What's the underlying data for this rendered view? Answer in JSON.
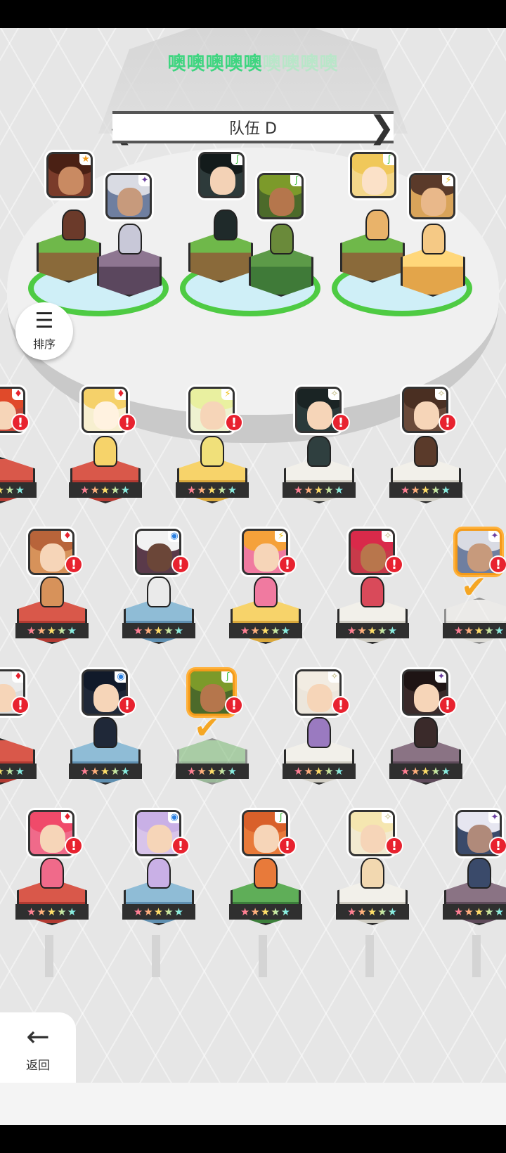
{
  "banner": {
    "lit_text": "噢噢噢噢噢",
    "dim_text": "噢噢噢噢"
  },
  "team": {
    "name": "队伍 D",
    "prev_arrow": "❮",
    "next_arrow": "❯"
  },
  "sort_button": {
    "label": "排序",
    "icon": "sort-icon"
  },
  "back_button": {
    "label": "返回",
    "icon": "back-arrow-icon"
  },
  "roster": {
    "star_text": "★★★★★",
    "alert_text": "!",
    "selected_mark": "✔"
  },
  "colors": {
    "accent_green": "#3fd580",
    "alert_red": "#e8222f",
    "selected_orange": "#f39a1a"
  }
}
